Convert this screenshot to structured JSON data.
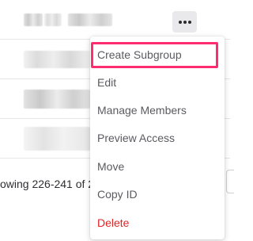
{
  "row_actions": {
    "more_icon": "ellipsis-icon"
  },
  "pagination": {
    "text": "owing 226-241 of 2"
  },
  "context_menu": {
    "items": [
      {
        "label": "Create Subgroup",
        "type": "normal"
      },
      {
        "label": "Edit",
        "type": "normal"
      },
      {
        "label": "Manage Members",
        "type": "normal"
      },
      {
        "label": "Preview Access",
        "type": "normal"
      },
      {
        "label": "Move",
        "type": "normal"
      },
      {
        "label": "Copy ID",
        "type": "normal"
      },
      {
        "label": "Delete",
        "type": "danger"
      }
    ],
    "highlighted_item": "Create Subgroup"
  },
  "colors": {
    "highlight": "#ff2d6f",
    "danger": "#e02424",
    "menu_text": "#5a5a60",
    "button_bg": "#e9e9ec"
  }
}
